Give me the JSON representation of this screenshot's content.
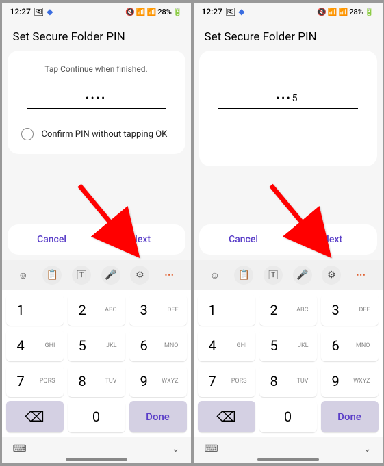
{
  "statusBar": {
    "time": "12:27",
    "battery": "28%"
  },
  "title": "Set Secure Folder PIN",
  "instruction": "Tap Continue when finished.",
  "checkboxLabel": "Confirm PIN without tapping OK",
  "buttons": {
    "cancel": "Cancel",
    "next": "Next"
  },
  "pins": {
    "left": "••••",
    "right": "•••5"
  },
  "keypad": {
    "keys": [
      {
        "n": "1",
        "l": ""
      },
      {
        "n": "2",
        "l": "ABC"
      },
      {
        "n": "3",
        "l": "DEF"
      },
      {
        "n": "4",
        "l": "GHI"
      },
      {
        "n": "5",
        "l": "JKL"
      },
      {
        "n": "6",
        "l": "MNO"
      },
      {
        "n": "7",
        "l": "PQRS"
      },
      {
        "n": "8",
        "l": "TUV"
      },
      {
        "n": "9",
        "l": "WXYZ"
      }
    ],
    "zero": "0",
    "done": "Done"
  }
}
